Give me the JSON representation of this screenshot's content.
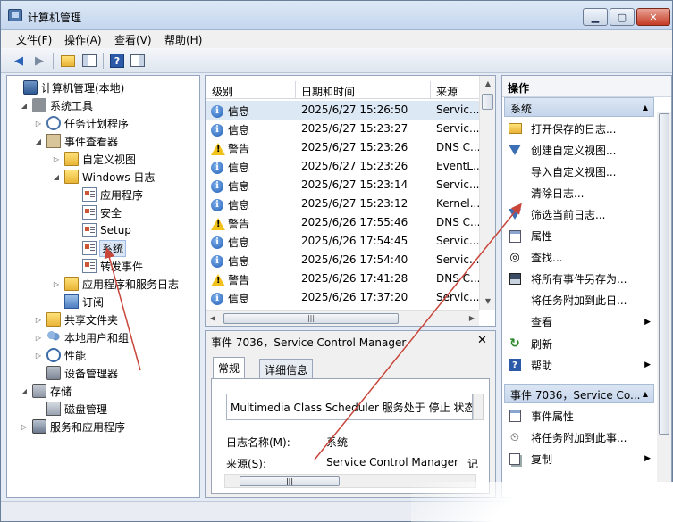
{
  "window": {
    "title": "计算机管理"
  },
  "controls": {
    "minimize": "▁",
    "maximize": "▢",
    "close": "✕"
  },
  "menu": [
    "文件(F)",
    "操作(A)",
    "查看(V)",
    "帮助(H)"
  ],
  "tree": [
    {
      "label": "计算机管理(本地)",
      "level": 0,
      "expander": "",
      "icon": "computer-icon"
    },
    {
      "label": "系统工具",
      "level": 1,
      "expander": "◢",
      "icon": "tools-icon"
    },
    {
      "label": "任务计划程序",
      "level": 2,
      "expander": "▷",
      "icon": "clock-icon"
    },
    {
      "label": "事件查看器",
      "level": 2,
      "expander": "◢",
      "icon": "event-viewer-icon"
    },
    {
      "label": "自定义视图",
      "level": 3,
      "expander": "▷",
      "icon": "folder-icon"
    },
    {
      "label": "Windows 日志",
      "level": 3,
      "expander": "◢",
      "icon": "folder-icon"
    },
    {
      "label": "应用程序",
      "level": 4,
      "expander": "",
      "icon": "log-icon"
    },
    {
      "label": "安全",
      "level": 4,
      "expander": "",
      "icon": "log-icon"
    },
    {
      "label": "Setup",
      "level": 4,
      "expander": "",
      "icon": "log-icon"
    },
    {
      "label": "系统",
      "level": 4,
      "expander": "",
      "icon": "log-icon",
      "selected": true
    },
    {
      "label": "转发事件",
      "level": 4,
      "expander": "",
      "icon": "log-icon"
    },
    {
      "label": "应用程序和服务日志",
      "level": 3,
      "expander": "▷",
      "icon": "folder-icon"
    },
    {
      "label": "订阅",
      "level": 3,
      "expander": "",
      "icon": "subscription-icon"
    },
    {
      "label": "共享文件夹",
      "level": 2,
      "expander": "▷",
      "icon": "folder-icon"
    },
    {
      "label": "本地用户和组",
      "level": 2,
      "expander": "▷",
      "icon": "users-icon"
    },
    {
      "label": "性能",
      "level": 2,
      "expander": "▷",
      "icon": "performance-icon"
    },
    {
      "label": "设备管理器",
      "level": 2,
      "expander": "",
      "icon": "device-icon"
    },
    {
      "label": "存储",
      "level": 1,
      "expander": "◢",
      "icon": "storage-icon"
    },
    {
      "label": "磁盘管理",
      "level": 2,
      "expander": "",
      "icon": "disk-icon"
    },
    {
      "label": "服务和应用程序",
      "level": 1,
      "expander": "▷",
      "icon": "services-icon"
    }
  ],
  "events": {
    "columns": [
      "级别",
      "日期和时间",
      "来源"
    ],
    "rows": [
      {
        "level": "信息",
        "type": "info",
        "datetime": "2025/6/27 15:26:50",
        "source": "Servic..."
      },
      {
        "level": "信息",
        "type": "info",
        "datetime": "2025/6/27 15:23:27",
        "source": "Servic..."
      },
      {
        "level": "警告",
        "type": "warn",
        "datetime": "2025/6/27 15:23:26",
        "source": "DNS C..."
      },
      {
        "level": "信息",
        "type": "info",
        "datetime": "2025/6/27 15:23:26",
        "source": "EventL..."
      },
      {
        "level": "信息",
        "type": "info",
        "datetime": "2025/6/27 15:23:14",
        "source": "Servic..."
      },
      {
        "level": "信息",
        "type": "info",
        "datetime": "2025/6/27 15:23:12",
        "source": "Kernel..."
      },
      {
        "level": "警告",
        "type": "warn",
        "datetime": "2025/6/26 17:55:46",
        "source": "DNS C..."
      },
      {
        "level": "信息",
        "type": "info",
        "datetime": "2025/6/26 17:54:45",
        "source": "Servic..."
      },
      {
        "level": "信息",
        "type": "info",
        "datetime": "2025/6/26 17:54:40",
        "source": "Servic..."
      },
      {
        "level": "警告",
        "type": "warn",
        "datetime": "2025/6/26 17:41:28",
        "source": "DNS C..."
      },
      {
        "level": "信息",
        "type": "info",
        "datetime": "2025/6/26 17:37:20",
        "source": "Servic..."
      }
    ]
  },
  "detail": {
    "title": "事件 7036，Service Control Manager",
    "tabs": [
      "常规",
      "详细信息"
    ],
    "description": "Multimedia Class Scheduler 服务处于 停止 状态。",
    "log_name_label": "日志名称(M):",
    "log_name_value": "系统",
    "source_label": "来源(S):",
    "source_value": "Service Control Manager",
    "source_trailing": "记"
  },
  "actions": {
    "header": "操作",
    "section1": "系统",
    "section1_items": [
      {
        "label": "打开保存的日志...",
        "icon": "open-log-icon"
      },
      {
        "label": "创建自定义视图...",
        "icon": "filter-icon"
      },
      {
        "label": "导入自定义视图...",
        "icon": ""
      },
      {
        "label": "清除日志...",
        "icon": ""
      },
      {
        "label": "筛选当前日志...",
        "icon": "filter-icon"
      },
      {
        "label": "属性",
        "icon": "properties-icon"
      },
      {
        "label": "查找...",
        "icon": "binoculars-icon"
      },
      {
        "label": "将所有事件另存为...",
        "icon": "save-icon"
      },
      {
        "label": "将任务附加到此日...",
        "icon": ""
      },
      {
        "label": "查看",
        "icon": "",
        "submenu": true
      },
      {
        "label": "刷新",
        "icon": "refresh-icon"
      },
      {
        "label": "帮助",
        "icon": "help-icon",
        "submenu": true
      }
    ],
    "section2": "事件 7036，Service Co...",
    "section2_items": [
      {
        "label": "事件属性",
        "icon": "properties-icon"
      },
      {
        "label": "将任务附加到此事...",
        "icon": "task-icon"
      },
      {
        "label": "复制",
        "icon": "copy-icon",
        "submenu": true
      }
    ]
  },
  "colors": {
    "accent": "#c43a23",
    "selection": "#dde8f5",
    "arrow": "#c8453a"
  }
}
